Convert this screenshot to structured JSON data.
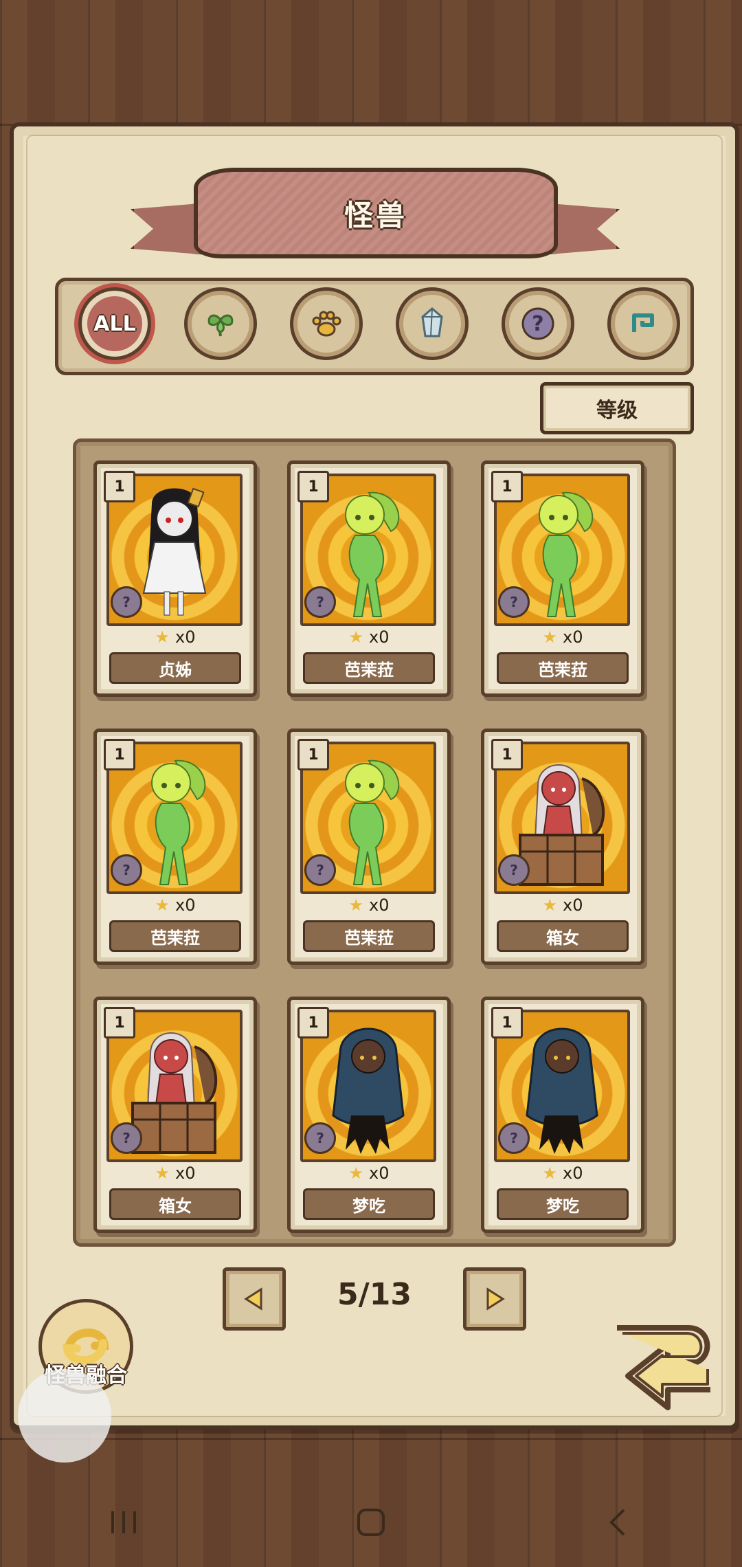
{
  "title": "怪兽",
  "filters": [
    {
      "id": "all",
      "label": "ALL",
      "active": true,
      "icon": "all-badge-icon"
    },
    {
      "id": "plant",
      "icon": "leaf-icon"
    },
    {
      "id": "beast",
      "icon": "paw-icon"
    },
    {
      "id": "mineral",
      "icon": "crystal-icon"
    },
    {
      "id": "mystery",
      "icon": "question-icon"
    },
    {
      "id": "special",
      "icon": "swirl-icon"
    }
  ],
  "sort_label": "等级",
  "cards": [
    {
      "level": "1",
      "stars": "x0",
      "name": "贞姊",
      "art": "ghost-girl"
    },
    {
      "level": "1",
      "stars": "x0",
      "name": "芭茉菈",
      "art": "green-girl"
    },
    {
      "level": "1",
      "stars": "x0",
      "name": "芭茉菈",
      "art": "green-girl"
    },
    {
      "level": "1",
      "stars": "x0",
      "name": "芭茉菈",
      "art": "green-girl"
    },
    {
      "level": "1",
      "stars": "x0",
      "name": "芭茉菈",
      "art": "green-girl"
    },
    {
      "level": "1",
      "stars": "x0",
      "name": "箱女",
      "art": "mimic-girl"
    },
    {
      "level": "1",
      "stars": "x0",
      "name": "箱女",
      "art": "mimic-girl"
    },
    {
      "level": "1",
      "stars": "x0",
      "name": "梦吃",
      "art": "dark-girl"
    },
    {
      "level": "1",
      "stars": "x0",
      "name": "梦吃",
      "art": "dark-girl"
    }
  ],
  "pager": {
    "label": "5/13"
  },
  "fusion_label": "怪兽融合",
  "colors": {
    "ribbon": "#c58d83",
    "portrait_bg": "#f0b02a",
    "green_skin": "#7ccc5a",
    "mimic_skin": "#c84a48",
    "dark_skin": "#2f4a63"
  }
}
